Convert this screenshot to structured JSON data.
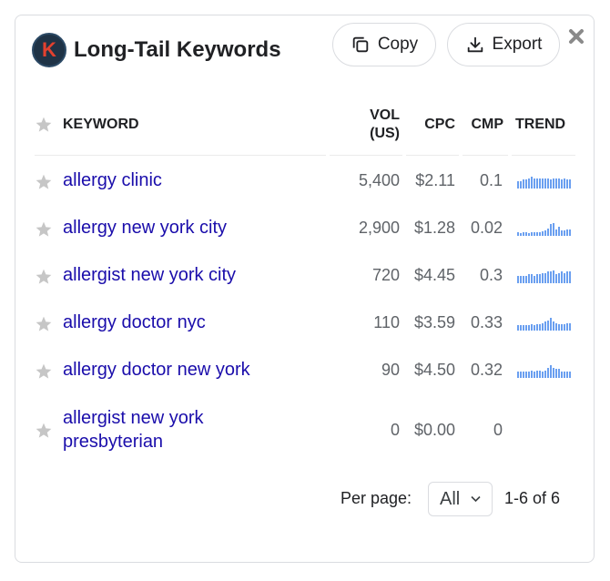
{
  "widget": {
    "title": "Long-Tail Keywords",
    "logo_letter": "K",
    "copy_label": "Copy",
    "export_label": "Export"
  },
  "columns": {
    "keyword": "KEYWORD",
    "vol_line1": "VOL",
    "vol_line2": "(US)",
    "cpc": "CPC",
    "cmp": "CMP",
    "trend": "TREND"
  },
  "rows": [
    {
      "keyword": "allergy clinic",
      "vol": "5,400",
      "cpc": "$2.11",
      "cmp": "0.1",
      "trend": [
        0.6,
        0.6,
        0.7,
        0.7,
        0.8,
        0.9,
        0.8,
        0.8,
        0.8,
        0.8,
        0.8,
        0.8,
        0.7,
        0.8,
        0.8,
        0.8,
        0.7,
        0.8,
        0.7,
        0.7
      ]
    },
    {
      "keyword": "allergy new york city",
      "vol": "2,900",
      "cpc": "$1.28",
      "cmp": "0.02",
      "trend": [
        0.3,
        0.2,
        0.25,
        0.3,
        0.2,
        0.25,
        0.3,
        0.3,
        0.3,
        0.35,
        0.45,
        0.6,
        0.9,
        1.0,
        0.5,
        0.7,
        0.4,
        0.45,
        0.5,
        0.5
      ]
    },
    {
      "keyword": "allergist new york city",
      "vol": "720",
      "cpc": "$4.45",
      "cmp": "0.3",
      "trend": [
        0.6,
        0.6,
        0.6,
        0.6,
        0.7,
        0.7,
        0.6,
        0.7,
        0.7,
        0.8,
        0.8,
        0.9,
        0.9,
        1.0,
        0.7,
        0.8,
        0.9,
        0.8,
        0.9,
        0.9
      ]
    },
    {
      "keyword": "allergy doctor nyc",
      "vol": "110",
      "cpc": "$3.59",
      "cmp": "0.33",
      "trend": [
        0.4,
        0.4,
        0.4,
        0.4,
        0.4,
        0.5,
        0.4,
        0.5,
        0.5,
        0.6,
        0.7,
        0.8,
        1.0,
        0.7,
        0.6,
        0.5,
        0.5,
        0.5,
        0.6,
        0.6
      ]
    },
    {
      "keyword": "allergy doctor new york",
      "vol": "90",
      "cpc": "$4.50",
      "cmp": "0.32",
      "trend": [
        0.5,
        0.5,
        0.5,
        0.5,
        0.5,
        0.6,
        0.5,
        0.6,
        0.6,
        0.5,
        0.6,
        0.8,
        1.0,
        0.8,
        0.7,
        0.7,
        0.5,
        0.5,
        0.5,
        0.5
      ]
    },
    {
      "keyword": "allergist new york presbyterian",
      "vol": "0",
      "cpc": "$0.00",
      "cmp": "0",
      "trend": []
    }
  ],
  "footer": {
    "per_page_label": "Per page:",
    "per_page_value": "All",
    "pagination": "1-6 of 6"
  },
  "colors": {
    "link": "#1a0dab",
    "trend_bar": "#6a9ff0",
    "star": "#c6c6c6"
  }
}
